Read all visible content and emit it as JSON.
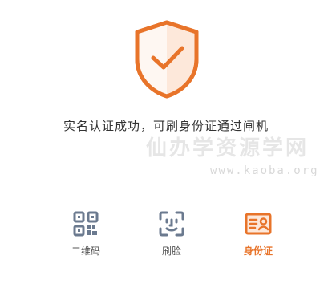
{
  "result": {
    "message": "实名认证成功，可刷身份证通过闸机"
  },
  "watermark": {
    "text": "仙办学资源学网",
    "url": "www.kaoba.org"
  },
  "tabs": [
    {
      "label": "二维码",
      "icon": "qr-code-icon",
      "active": false
    },
    {
      "label": "刷脸",
      "icon": "face-scan-icon",
      "active": false
    },
    {
      "label": "身份证",
      "icon": "id-card-icon",
      "active": true
    }
  ],
  "colors": {
    "accent": "#e8742a",
    "accent_light": "#fde8da",
    "icon_gray": "#6b7a8f",
    "text": "#333333"
  }
}
